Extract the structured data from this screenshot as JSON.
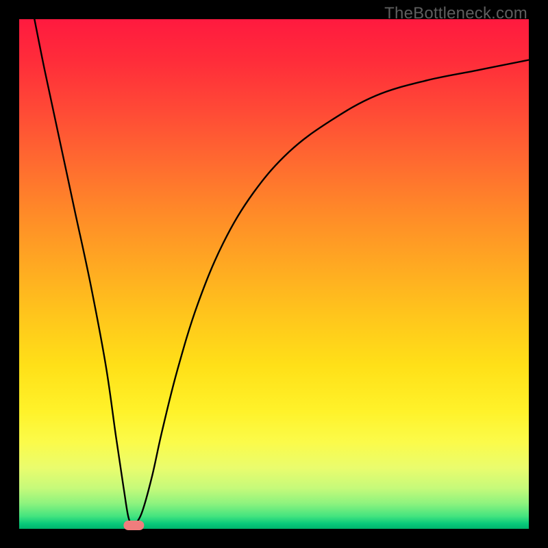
{
  "watermark": "TheBottleneck.com",
  "chart_data": {
    "type": "line",
    "title": "",
    "xlabel": "",
    "ylabel": "",
    "xlim": [
      0,
      100
    ],
    "ylim": [
      0,
      100
    ],
    "gradient_background": {
      "orientation": "vertical",
      "top_color": "#ff1a3f",
      "bottom_color": "#00b36b"
    },
    "series": [
      {
        "name": "bottleneck-curve",
        "x": [
          3,
          5,
          8,
          11,
          14,
          17,
          19,
          20.5,
          21.5,
          22.5,
          24,
          26,
          28,
          31,
          35,
          40,
          46,
          53,
          61,
          70,
          80,
          90,
          100
        ],
        "y": [
          100,
          90,
          76,
          62,
          48,
          32,
          18,
          8,
          2,
          1,
          3,
          10,
          19,
          31,
          44,
          56,
          66,
          74,
          80,
          85,
          88,
          90,
          92
        ]
      }
    ],
    "marker": {
      "name": "optimal-point",
      "x": 22.5,
      "y": 0,
      "shape": "capsule",
      "color": "#f07d7d"
    }
  }
}
